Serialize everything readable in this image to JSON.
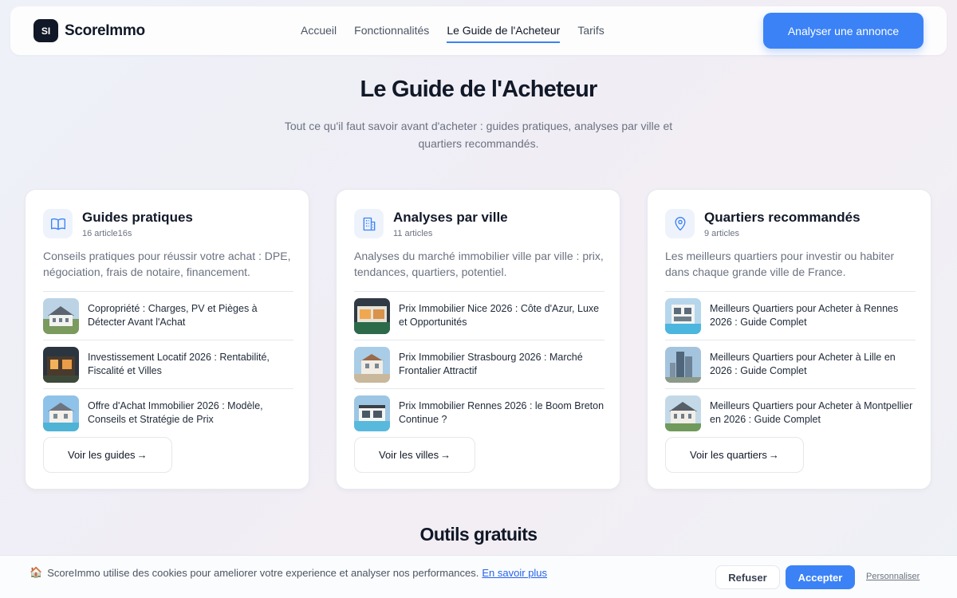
{
  "header": {
    "logo_mark": "SI",
    "brand": "ScoreImmo",
    "nav": [
      {
        "label": "Accueil"
      },
      {
        "label": "Fonctionnalités"
      },
      {
        "label": "Le Guide de l'Acheteur"
      },
      {
        "label": "Tarifs"
      }
    ],
    "active_nav": "Le Guide de l'Acheteur",
    "cta_label": "Analyser une annonce",
    "accent_color": "#3b82f6"
  },
  "hero": {
    "title": "Le Guide de l'Acheteur",
    "subtitle": "Tout ce qu'il faut savoir avant d'acheter : guides pratiques, analyses par ville et quartiers recommandés."
  },
  "cards": [
    {
      "icon": "book-icon",
      "title": "Guides pratiques",
      "count": "16 article16s",
      "description": "Conseils pratiques pour réussir votre achat : DPE, négociation, frais de notaire, financement.",
      "articles": [
        {
          "title": "Copropriété : Charges, PV et Pièges à Détecter Avant l'Achat"
        },
        {
          "title": "Investissement Locatif 2026 : Rentabilité, Fiscalité et Villes"
        },
        {
          "title": "Offre d'Achat Immobilier 2026 : Modèle, Conseils et Stratégie de Prix"
        }
      ],
      "button": "Voir les guides"
    },
    {
      "icon": "building-icon",
      "title": "Analyses par ville",
      "count": "11 articles",
      "description": "Analyses du marché immobilier ville par ville : prix, tendances, quartiers, potentiel.",
      "articles": [
        {
          "title": "Prix Immobilier Nice 2026 : Côte d'Azur, Luxe et Opportunités"
        },
        {
          "title": "Prix Immobilier Strasbourg 2026 : Marché Frontalier Attractif"
        },
        {
          "title": "Prix Immobilier Rennes 2026 : le Boom Breton Continue ?"
        }
      ],
      "button": "Voir les villes"
    },
    {
      "icon": "map-pin-icon",
      "title": "Quartiers recommandés",
      "count": "9 articles",
      "description": "Les meilleurs quartiers pour investir ou habiter dans chaque grande ville de France.",
      "articles": [
        {
          "title": "Meilleurs Quartiers pour Acheter à Rennes 2026 : Guide Complet"
        },
        {
          "title": "Meilleurs Quartiers pour Acheter à Lille en 2026 : Guide Complet"
        },
        {
          "title": "Meilleurs Quartiers pour Acheter à Montpellier en 2026 : Guide Complet"
        }
      ],
      "button": "Voir les quartiers"
    }
  ],
  "tools_title": "Outils gratuits",
  "cookie": {
    "icon": "house-emoji",
    "text": "ScoreImmo utilise des cookies pour ameliorer votre experience et analyser nos performances.",
    "link": "En savoir plus",
    "refuse": "Refuser",
    "accept": "Accepter",
    "customize": "Personnaliser"
  }
}
